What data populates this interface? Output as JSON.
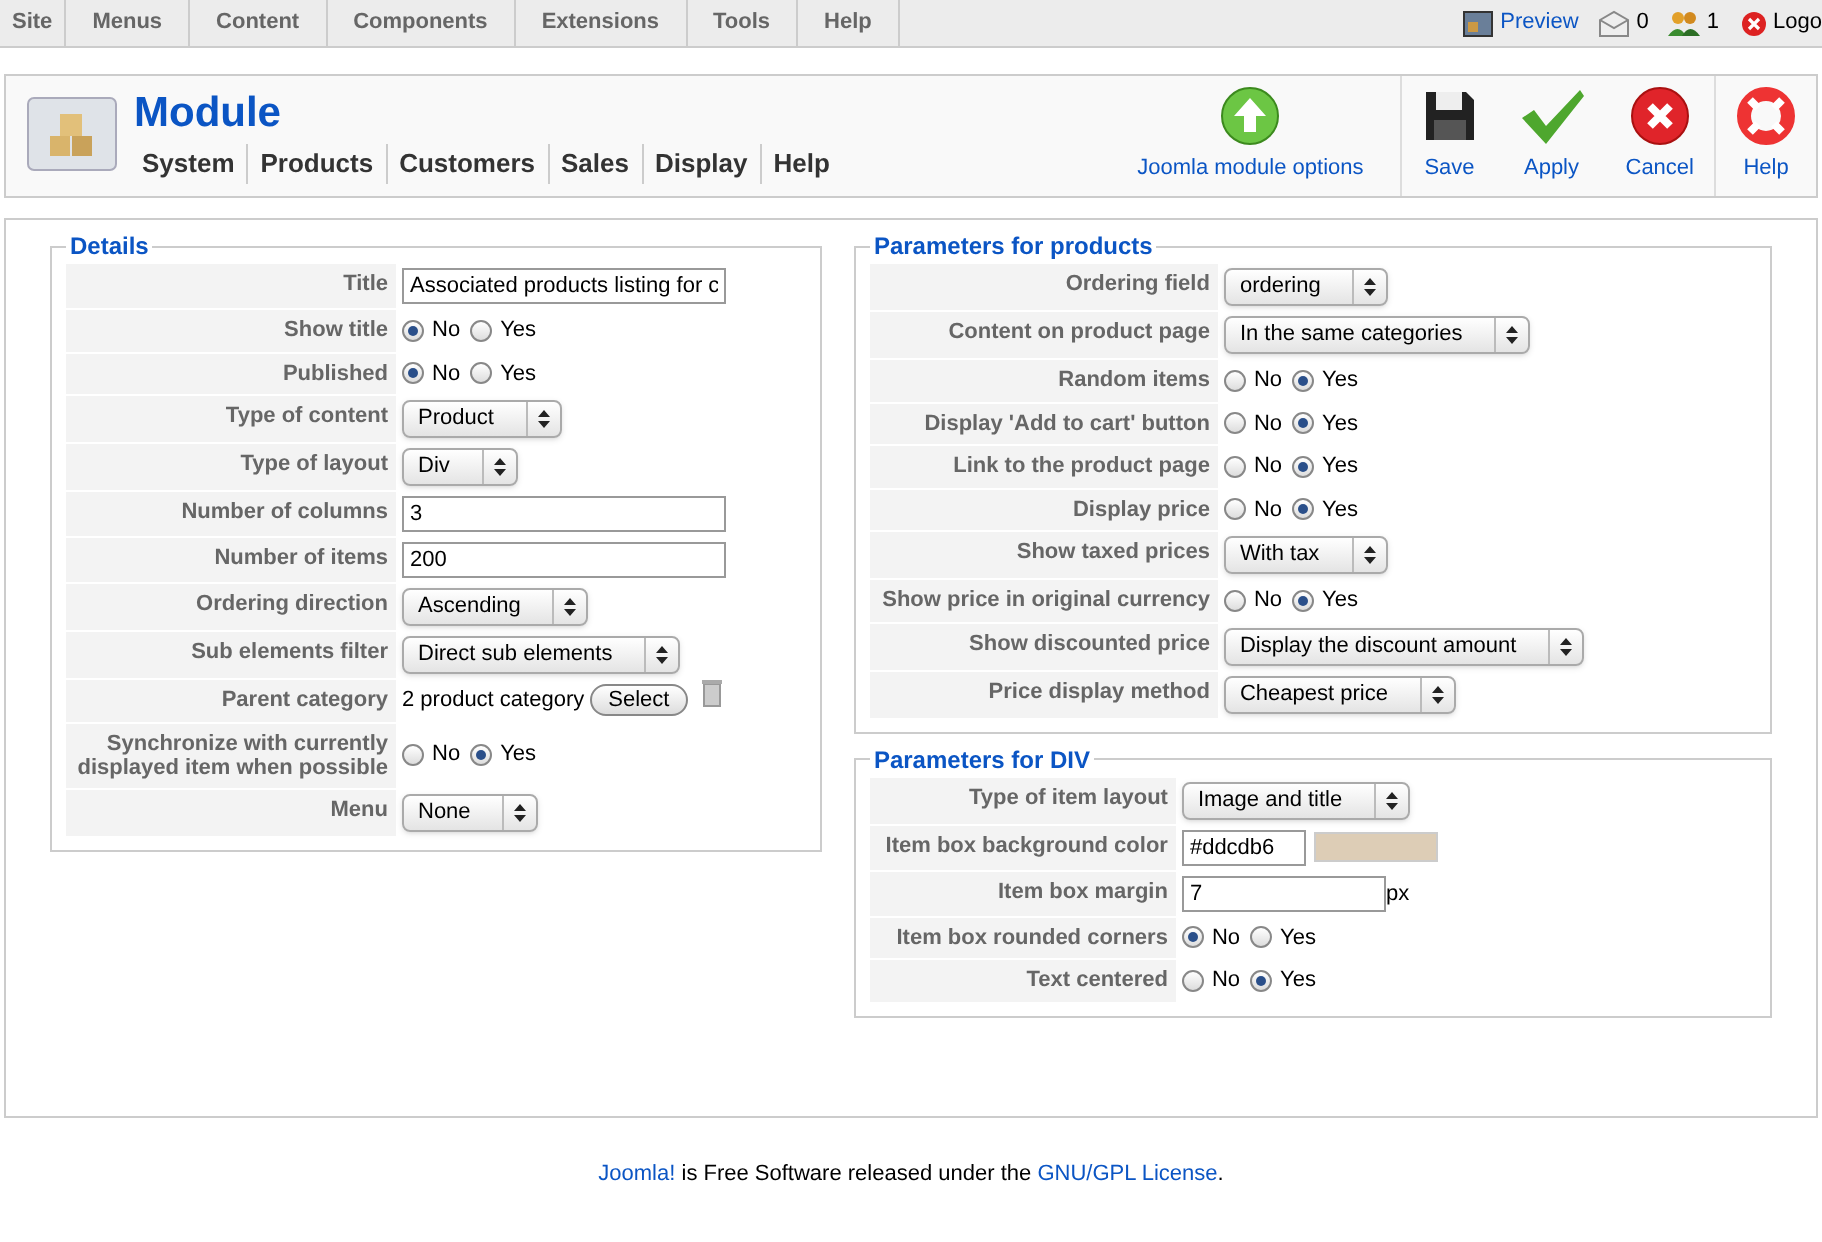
{
  "menu_bar": {
    "items": [
      "Site",
      "Menus",
      "Content",
      "Components",
      "Extensions",
      "Tools",
      "Help"
    ],
    "status": [
      {
        "kind": "preview",
        "label": "Preview"
      },
      {
        "kind": "messages",
        "label": "0"
      },
      {
        "kind": "users",
        "label": "1"
      },
      {
        "kind": "logout",
        "label": "Logo"
      }
    ]
  },
  "header": {
    "title": "Module",
    "nav": [
      "System",
      "Products",
      "Customers",
      "Sales",
      "Display",
      "Help"
    ],
    "toolbar": [
      {
        "kind": "options",
        "label": "Joomla module options"
      },
      {
        "kind": "save",
        "label": "Save"
      },
      {
        "kind": "apply",
        "label": "Apply"
      },
      {
        "kind": "cancel",
        "label": "Cancel"
      },
      {
        "kind": "help",
        "label": "Help"
      }
    ]
  },
  "sections": [
    {
      "title": "Details",
      "rows": [
        {
          "label": "Title",
          "kind": "text",
          "value": "Associated products listing for c"
        },
        {
          "label": "Show title",
          "kind": "radio",
          "options": [
            {
              "label": "No",
              "selected": true
            },
            {
              "label": "Yes",
              "selected": false
            }
          ]
        },
        {
          "label": "Published",
          "kind": "radio",
          "options": [
            {
              "label": "No",
              "selected": true
            },
            {
              "label": "Yes",
              "selected": false
            }
          ]
        },
        {
          "label": "Type of content",
          "kind": "select",
          "value": "Product"
        },
        {
          "label": "Type of layout",
          "kind": "select",
          "value": "Div"
        },
        {
          "label": "Number of columns",
          "kind": "text",
          "value": "3"
        },
        {
          "label": "Number of items",
          "kind": "text",
          "value": "200"
        },
        {
          "label": "Ordering direction",
          "kind": "select",
          "value": "Ascending"
        },
        {
          "label": "Sub elements filter",
          "kind": "select",
          "value": "Direct sub elements"
        },
        {
          "label": "Parent category",
          "kind": "category",
          "value": "2 product category",
          "button": "Select"
        },
        {
          "label": "Synchronize with currently displayed item when possible",
          "kind": "radio",
          "options": [
            {
              "label": "No",
              "selected": false
            },
            {
              "label": "Yes",
              "selected": true
            }
          ]
        },
        {
          "label": "Menu",
          "kind": "select",
          "value": "None"
        }
      ]
    },
    {
      "title": "Parameters for products",
      "rows": [
        {
          "label": "Ordering field",
          "kind": "select",
          "value": "ordering"
        },
        {
          "label": "Content on product page",
          "kind": "select",
          "value": "In the same categories"
        },
        {
          "label": "Random items",
          "kind": "radio",
          "options": [
            {
              "label": "No",
              "selected": false
            },
            {
              "label": "Yes",
              "selected": true
            }
          ]
        },
        {
          "label": "Display 'Add to cart' button",
          "kind": "radio",
          "options": [
            {
              "label": "No",
              "selected": false
            },
            {
              "label": "Yes",
              "selected": true
            }
          ]
        },
        {
          "label": "Link to the product page",
          "kind": "radio",
          "options": [
            {
              "label": "No",
              "selected": false
            },
            {
              "label": "Yes",
              "selected": true
            }
          ]
        },
        {
          "label": "Display price",
          "kind": "radio",
          "options": [
            {
              "label": "No",
              "selected": false
            },
            {
              "label": "Yes",
              "selected": true
            }
          ]
        },
        {
          "label": "Show taxed prices",
          "kind": "select",
          "value": "With tax"
        },
        {
          "label": "Show price in original currency",
          "kind": "radio",
          "options": [
            {
              "label": "No",
              "selected": false
            },
            {
              "label": "Yes",
              "selected": true
            }
          ]
        },
        {
          "label": "Show discounted price",
          "kind": "select",
          "value": "Display the discount amount"
        },
        {
          "label": "Price display method",
          "kind": "select",
          "value": "Cheapest price"
        }
      ]
    },
    {
      "title": "Parameters for DIV",
      "rows": [
        {
          "label": "Type of item layout",
          "kind": "select",
          "value": "Image and title"
        },
        {
          "label": "Item box background color",
          "kind": "color",
          "value": "#ddcdb6",
          "color": "#ddcdb6"
        },
        {
          "label": "Item box margin",
          "kind": "unit",
          "value": "7",
          "unit": "px"
        },
        {
          "label": "Item box rounded corners",
          "kind": "radio",
          "options": [
            {
              "label": "No",
              "selected": true
            },
            {
              "label": "Yes",
              "selected": false
            }
          ]
        },
        {
          "label": "Text centered",
          "kind": "radio",
          "options": [
            {
              "label": "No",
              "selected": false
            },
            {
              "label": "Yes",
              "selected": true
            }
          ]
        }
      ]
    }
  ],
  "footer": {
    "link": "Joomla!",
    "text": "is Free Software released under the",
    "license": "GNU/GPL License",
    "end": "."
  }
}
